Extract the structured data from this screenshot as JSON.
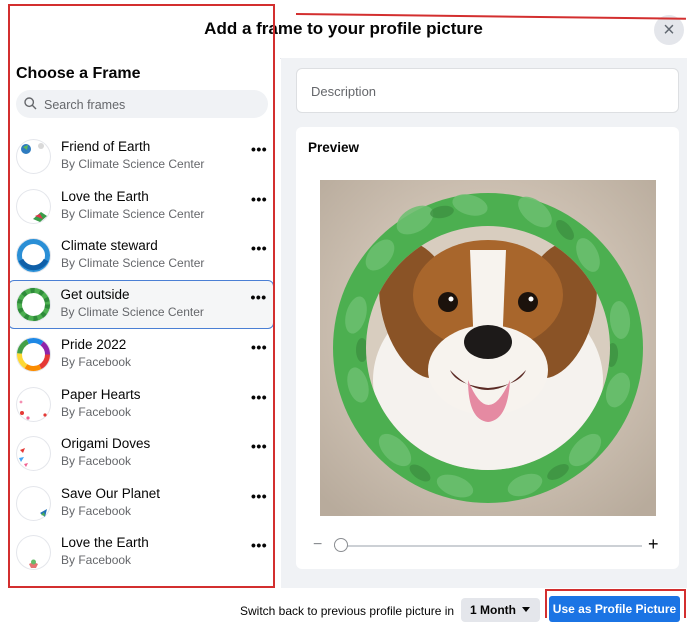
{
  "header": {
    "title": "Add a frame to your profile picture",
    "close_label": "×"
  },
  "sidebar": {
    "title": "Choose a Frame",
    "search_placeholder": "Search frames",
    "more_label": "•••",
    "frames": [
      {
        "name": "Friend of Earth",
        "author": "By Climate Science Center"
      },
      {
        "name": "Love the Earth",
        "author": "By Climate Science Center"
      },
      {
        "name": "Climate steward",
        "author": "By Climate Science Center"
      },
      {
        "name": "Get outside",
        "author": "By Climate Science Center",
        "selected": true
      },
      {
        "name": "Pride 2022",
        "author": "By Facebook"
      },
      {
        "name": "Paper Hearts",
        "author": "By Facebook"
      },
      {
        "name": "Origami Doves",
        "author": "By Facebook"
      },
      {
        "name": "Save Our Planet",
        "author": "By Facebook"
      },
      {
        "name": "Love the Earth",
        "author": "By Facebook"
      }
    ]
  },
  "main": {
    "description_placeholder": "Description",
    "preview_label": "Preview",
    "zoom_minus": "−",
    "zoom_plus": "+",
    "zoom_level": 0
  },
  "footer": {
    "switch_text": "Switch back to previous profile picture in",
    "duration": "1 Month",
    "use_button": "Use as Profile Picture"
  },
  "colors": {
    "accent": "#1b74e4",
    "highlight": "#d32f2f",
    "selected_border": "#4a7fd4",
    "frame_green": "#4caf50"
  }
}
